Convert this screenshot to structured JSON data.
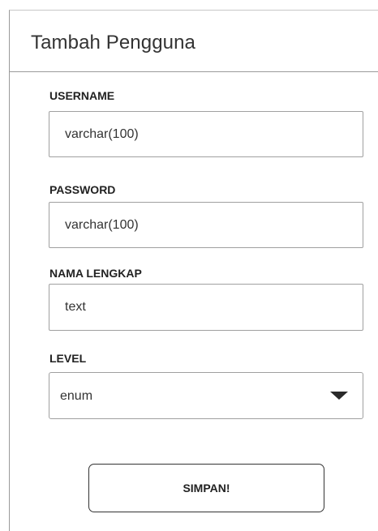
{
  "form": {
    "title": "Tambah Pengguna",
    "fields": {
      "username": {
        "label": "USERNAME",
        "value": "varchar(100)"
      },
      "password": {
        "label": "PASSWORD",
        "value": "varchar(100)"
      },
      "nama_lengkap": {
        "label": "NAMA LENGKAP",
        "value": "text"
      },
      "level": {
        "label": "LEVEL",
        "selected": "enum"
      }
    },
    "submit_label": "SIMPAN!"
  }
}
